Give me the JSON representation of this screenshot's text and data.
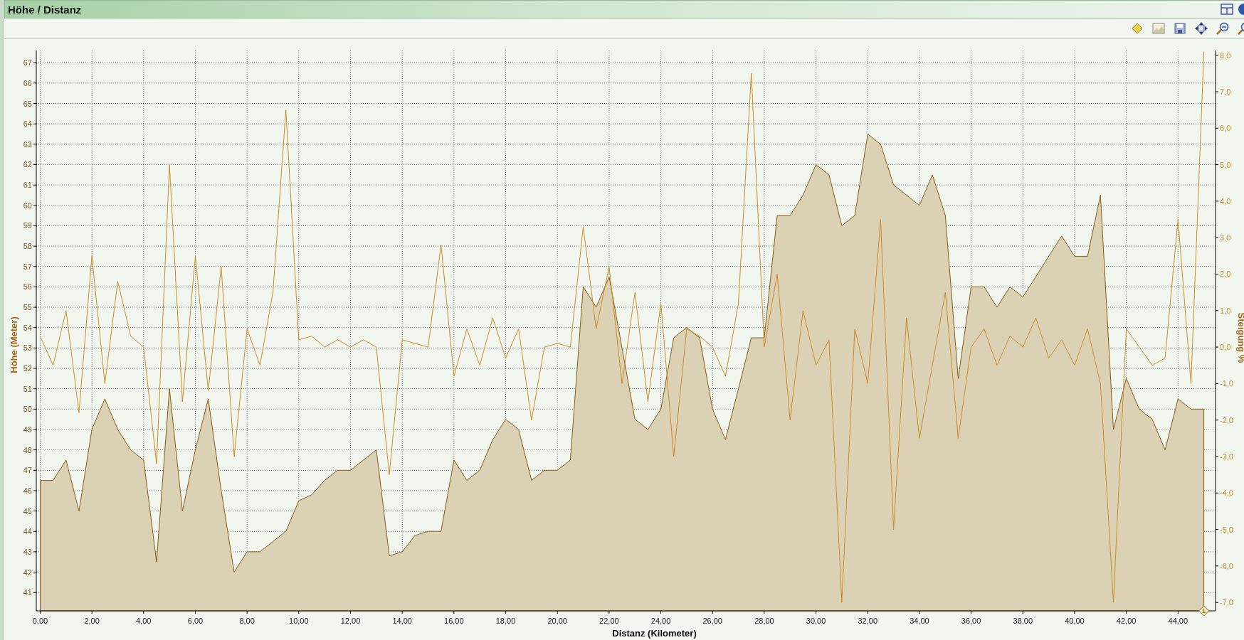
{
  "panel": {
    "title": "Höhe / Distanz"
  },
  "chart": {
    "chart_data": {
      "type": "area",
      "grid": true,
      "xlabel": "Distanz (Kilometer)",
      "xlim": [
        -0.15,
        45.45
      ],
      "xticks": [
        {
          "value": 0,
          "label": "0,00"
        },
        {
          "value": 2,
          "label": "2,00"
        },
        {
          "value": 4,
          "label": "4,00"
        },
        {
          "value": 6,
          "label": "6,00"
        },
        {
          "value": 8,
          "label": "8,00"
        },
        {
          "value": 10,
          "label": "10,00"
        },
        {
          "value": 12,
          "label": "12,00"
        },
        {
          "value": 14,
          "label": "14,00"
        },
        {
          "value": 16,
          "label": "16,00"
        },
        {
          "value": 18,
          "label": "18,00"
        },
        {
          "value": 20,
          "label": "20,00"
        },
        {
          "value": 22,
          "label": "22,00"
        },
        {
          "value": 24,
          "label": "24,00"
        },
        {
          "value": 26,
          "label": "26,00"
        },
        {
          "value": 28,
          "label": "28,00"
        },
        {
          "value": 30,
          "label": "30,00"
        },
        {
          "value": 32,
          "label": "32,00"
        },
        {
          "value": 34,
          "label": "34,00"
        },
        {
          "value": 36,
          "label": "36,00"
        },
        {
          "value": 38,
          "label": "38,00"
        },
        {
          "value": 40,
          "label": "40,00"
        },
        {
          "value": 42,
          "label": "42,00"
        },
        {
          "value": 44,
          "label": "44,00"
        }
      ],
      "ylabel": "Höhe (Meter)",
      "ylim": [
        40.1,
        67.6
      ],
      "yticks": [
        41,
        42,
        43,
        44,
        45,
        46,
        47,
        48,
        49,
        50,
        51,
        52,
        53,
        54,
        55,
        56,
        57,
        58,
        59,
        60,
        61,
        62,
        63,
        64,
        65,
        66,
        67
      ],
      "y2label": "Steigung %",
      "y2lim": [
        -7.23,
        8.13
      ],
      "y2ticks": [
        {
          "value": -7,
          "label": "-7,0"
        },
        {
          "value": -6,
          "label": "-6,0"
        },
        {
          "value": -5,
          "label": "-5,0"
        },
        {
          "value": -4,
          "label": "-4,0"
        },
        {
          "value": -3,
          "label": "-3,0"
        },
        {
          "value": -2,
          "label": "-2,0"
        },
        {
          "value": -1,
          "label": "-1,0"
        },
        {
          "value": 0,
          "label": "0,0"
        },
        {
          "value": 1,
          "label": "1,0"
        },
        {
          "value": 2,
          "label": "2,0"
        },
        {
          "value": 3,
          "label": "3,0"
        },
        {
          "value": 4,
          "label": "4,0"
        },
        {
          "value": 5,
          "label": "5,0"
        },
        {
          "value": 6,
          "label": "6,0"
        },
        {
          "value": 7,
          "label": "7,0"
        },
        {
          "value": 8,
          "label": "8,0"
        }
      ],
      "x": [
        0,
        0.5,
        1,
        1.5,
        2,
        2.5,
        3,
        3.5,
        4,
        4.5,
        5,
        5.5,
        6,
        6.5,
        7,
        7.5,
        8,
        8.5,
        9,
        9.5,
        10,
        10.5,
        11,
        11.5,
        12,
        12.5,
        13,
        13.5,
        14,
        14.5,
        15,
        15.5,
        16,
        16.5,
        17,
        17.5,
        18,
        18.5,
        19,
        19.5,
        20,
        20.5,
        21,
        21.5,
        22,
        22.5,
        23,
        23.5,
        24,
        24.5,
        25,
        25.5,
        26,
        26.5,
        27,
        27.5,
        28,
        28.5,
        29,
        29.5,
        30,
        30.5,
        31,
        31.5,
        32,
        32.5,
        33,
        33.5,
        34,
        34.5,
        35,
        35.5,
        36,
        36.5,
        37,
        37.5,
        38,
        38.5,
        39,
        39.5,
        40,
        40.5,
        41,
        41.5,
        42,
        42.5,
        43,
        43.5,
        44,
        44.5,
        45
      ],
      "series": [
        {
          "color": "#8a5a12",
          "values": [
            46.5,
            46.5,
            47.5,
            45,
            49,
            50.5,
            49,
            48,
            47.5,
            42.5,
            51,
            45,
            48,
            50.5,
            46,
            42,
            43,
            43,
            43.5,
            44,
            45.5,
            45.8,
            46.5,
            47,
            47,
            47.5,
            48,
            42.8,
            43,
            43.8,
            44,
            44,
            47.5,
            46.5,
            47,
            48.5,
            49.5,
            49,
            46.5,
            47,
            47,
            47.5,
            56,
            55,
            56.5,
            53,
            49.5,
            49,
            50,
            53.5,
            54,
            53.5,
            50,
            48.5,
            51,
            53.5,
            53.5,
            59.5,
            59.5,
            60.5,
            62,
            61.5,
            59,
            59.5,
            63.5,
            63,
            61,
            60.5,
            60,
            61.5,
            59.5,
            51.5,
            56,
            56,
            55,
            56,
            55.5,
            56.5,
            57.5,
            58.5,
            57.5,
            57.5,
            60.5,
            49,
            51.5,
            50,
            49.5,
            48,
            50.5,
            50,
            50
          ]
        },
        {
          "type": "line",
          "axis": "y2",
          "color": "#d08a20",
          "values": [
            0.3,
            -0.5,
            1.0,
            -1.8,
            2.5,
            -1,
            1.8,
            0.3,
            0,
            -3.2,
            5.0,
            -1.5,
            2.5,
            -1.2,
            2.2,
            -3,
            0.5,
            -0.5,
            1.5,
            6.5,
            0.2,
            0.3,
            0,
            0.2,
            0,
            0.2,
            0,
            -3.5,
            0.2,
            0.1,
            0,
            2.8,
            -0.8,
            0.5,
            -0.5,
            0.8,
            -0.3,
            0.5,
            -2,
            0,
            0.1,
            0,
            3.3,
            0.5,
            2.2,
            -1,
            1.5,
            -1.5,
            1.2,
            -3,
            0.5,
            0.3,
            0,
            -0.8,
            1.2,
            7.5,
            0,
            2,
            -2,
            1,
            -0.5,
            0.2,
            -7,
            0.5,
            -1,
            3.5,
            -5,
            0.8,
            -2.5,
            -0.5,
            1.5,
            -2.5,
            0,
            0.5,
            -0.5,
            0.3,
            0,
            0.8,
            -0.3,
            0.2,
            -0.5,
            0.5,
            -1,
            -7,
            0.5,
            0,
            -0.5,
            -0.3,
            3.5,
            -1,
            8.1
          ]
        }
      ],
      "annotations": [
        {
          "x": 45,
          "text": "1"
        }
      ]
    }
  }
}
